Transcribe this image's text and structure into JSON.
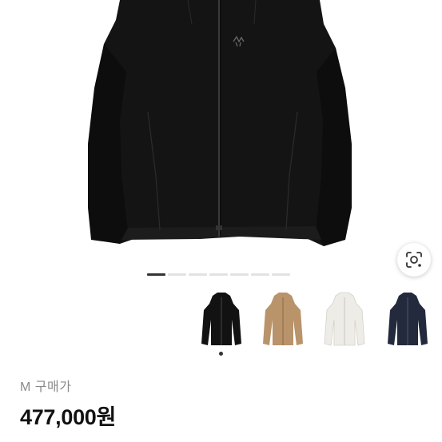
{
  "product": {
    "size_label": "M 구매가",
    "price": "477,000원"
  },
  "gallery": {
    "page_count": 7,
    "active_index": 0
  },
  "variants": [
    {
      "name": "black-jacket",
      "color": "#121212",
      "selected": true
    },
    {
      "name": "tan-jacket",
      "color": "#b9936a",
      "selected": false
    },
    {
      "name": "white-jacket",
      "color": "#eeece6",
      "selected": false
    },
    {
      "name": "navy-jacket",
      "color": "#232a3d",
      "selected": false
    }
  ],
  "icons": {
    "lens": "lens-search-icon",
    "logo": "bird-logo-icon"
  }
}
